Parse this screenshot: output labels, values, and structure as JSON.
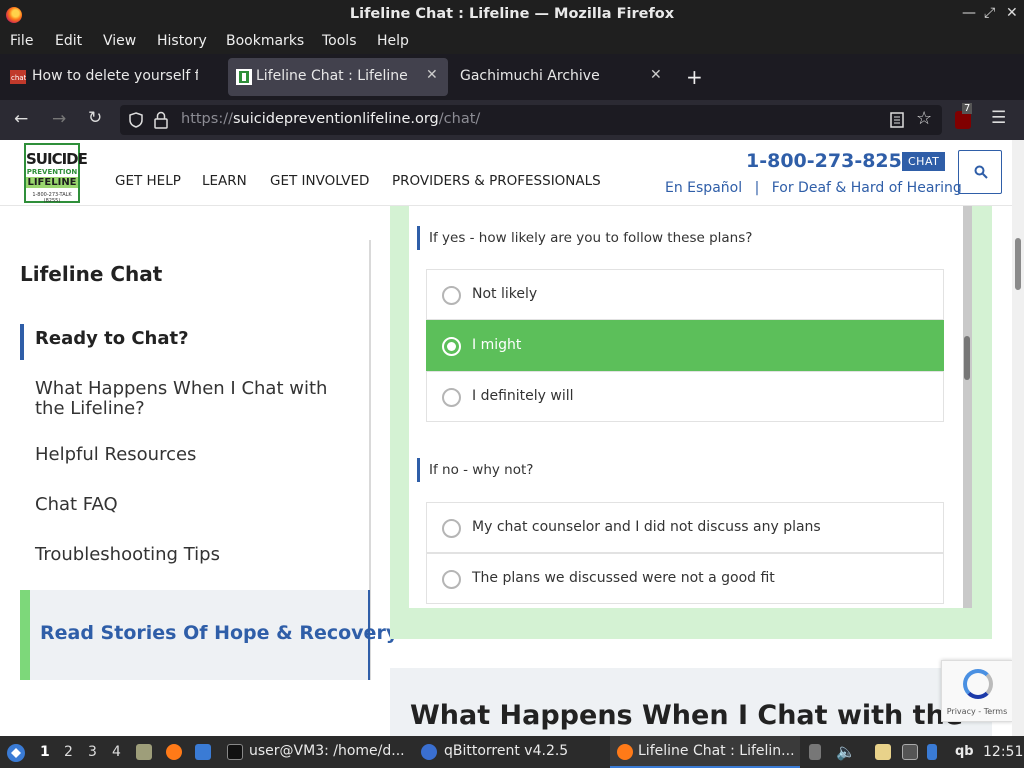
{
  "window": {
    "title": "Lifeline Chat : Lifeline — Mozilla Firefox"
  },
  "menubar": [
    "File",
    "Edit",
    "View",
    "History",
    "Bookmarks",
    "Tools",
    "Help"
  ],
  "tabs": [
    {
      "label": "How to delete yourself fr",
      "active": false
    },
    {
      "label": "Lifeline Chat : Lifeline",
      "active": true
    },
    {
      "label": "Gachimuchi Archive",
      "active": false
    }
  ],
  "navbar": {
    "url_prefix": "https://",
    "url_domain": "suicidepreventionlifeline.org",
    "url_path": "/chat/",
    "extension_badge": "7"
  },
  "site": {
    "logo": {
      "line1": "SUICIDE",
      "line2": "PREVENTION",
      "line3": "LIFELINE",
      "line4": "1-800-273-TALK (8255)"
    },
    "nav": [
      "GET HELP",
      "LEARN",
      "GET INVOLVED",
      "PROVIDERS & PROFESSIONALS"
    ],
    "phone": "1-800-273-8255",
    "chat_badge": "CHAT",
    "spanish": "En Español",
    "separator": "|",
    "deaf": "For Deaf & Hard of Hearing"
  },
  "sidebar": {
    "title": "Lifeline Chat",
    "items": [
      "Ready to Chat?",
      "What Happens When I Chat with the Lifeline?",
      "Helpful Resources",
      "Chat FAQ",
      "Troubleshooting Tips"
    ],
    "hope_link": "Read Stories Of Hope & Recovery"
  },
  "survey": {
    "q1": {
      "label": "If yes - how likely are you to follow these plans?",
      "options": [
        "Not likely",
        "I might",
        "I definitely will"
      ],
      "selected": "I might"
    },
    "q2": {
      "label": "If no - why not?",
      "options": [
        "My chat counselor and I did not discuss any plans",
        "The plans we discussed were not a good fit"
      ]
    }
  },
  "lower_heading": "What Happens When I Chat with the",
  "recaptcha": {
    "privacy": "Privacy",
    "dash": "-",
    "terms": "Terms"
  },
  "taskbar": {
    "workspaces": [
      "1",
      "2",
      "3",
      "4"
    ],
    "tasks": [
      "user@VM3: /home/d...",
      "qBittorrent v4.2.5",
      "Lifeline Chat : Lifelin..."
    ],
    "tray_text": "qb",
    "clock": "12:51"
  },
  "colors": {
    "accent_blue": "#2f5ea8",
    "selected_green": "#5cbf5a",
    "frame_green": "#d4f2d3"
  }
}
